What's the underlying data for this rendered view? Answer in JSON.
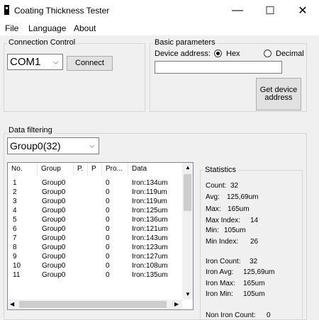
{
  "window": {
    "title": "Coating Thickness Tester",
    "minimize": "—",
    "maximize": "☐",
    "close": "✕"
  },
  "menu": [
    "File",
    "Language",
    "About"
  ],
  "connection": {
    "label": "Connection Control",
    "port": "COM1",
    "connect_label": "Connect"
  },
  "basic": {
    "label": "Basic parameters",
    "device_address_label": "Device address:",
    "hex_label": "Hex",
    "decimal_label": "Decimal",
    "address_value": "",
    "get_address_label": "Get device address"
  },
  "filtering": {
    "label": "Data filtering",
    "group_value": "Group0(32)"
  },
  "table": {
    "headers": [
      "No.",
      "Group",
      "P.",
      "P",
      "Pro...",
      "Data"
    ],
    "rows": [
      [
        "1",
        "Group0",
        "",
        "",
        "0",
        "Iron:134um"
      ],
      [
        "2",
        "Group0",
        "",
        "",
        "0",
        "Iron:119um"
      ],
      [
        "3",
        "Group0",
        "",
        "",
        "0",
        "Iron:119um"
      ],
      [
        "4",
        "Group0",
        "",
        "",
        "0",
        "Iron:125um"
      ],
      [
        "5",
        "Group0",
        "",
        "",
        "0",
        "Iron:136um"
      ],
      [
        "6",
        "Group0",
        "",
        "",
        "0",
        "Iron:121um"
      ],
      [
        "7",
        "Group0",
        "",
        "",
        "0",
        "Iron:143um"
      ],
      [
        "8",
        "Group0",
        "",
        "",
        "0",
        "Iron:123um"
      ],
      [
        "9",
        "Group0",
        "",
        "",
        "0",
        "Iron:127um"
      ],
      [
        "10",
        "Group0",
        "",
        "",
        "0",
        "Iron:108um"
      ],
      [
        "11",
        "Group0",
        "",
        "",
        "0",
        "Iron:135um"
      ]
    ]
  },
  "statistics": {
    "label": "Statistics",
    "count": {
      "label": "Count:",
      "value": "32"
    },
    "avg": {
      "label": "Avg:",
      "value": "125,69um"
    },
    "max": {
      "label": "Max:",
      "value": "165um"
    },
    "max_index": {
      "label": "Max Index:",
      "value": "14"
    },
    "min": {
      "label": "Min:",
      "value": "105um"
    },
    "min_index": {
      "label": "Min Index:",
      "value": "26"
    },
    "iron_count": {
      "label": "Iron Count:",
      "value": "32"
    },
    "iron_avg": {
      "label": "Iron Avg:",
      "value": "125,69um"
    },
    "iron_max": {
      "label": "Iron Max:",
      "value": "165um"
    },
    "iron_min": {
      "label": "Iron Min:",
      "value": "105um"
    },
    "non_iron_count": {
      "label": "Non Iron Count:",
      "value": "0"
    }
  }
}
